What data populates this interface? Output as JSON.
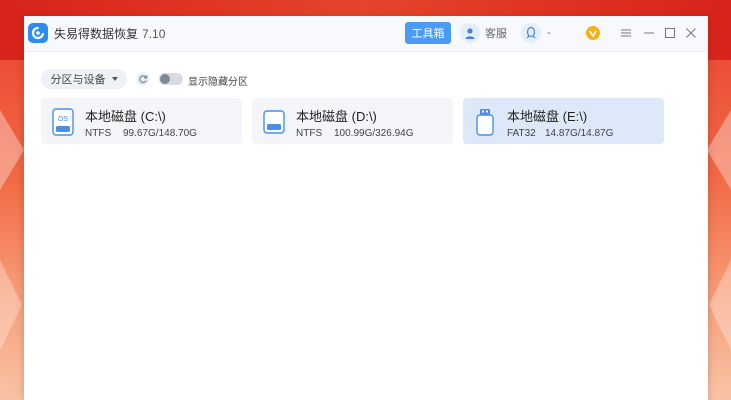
{
  "app": {
    "title": "失易得数据恢复",
    "version": "7.10"
  },
  "titlebar": {
    "toolbox_label": "工具箱",
    "service_label": "客服",
    "account_label": "-"
  },
  "filter": {
    "dropdown_label": "分区与设备",
    "toggle_label": "显示隐藏分区",
    "toggle_on": false
  },
  "disks": [
    {
      "name": "本地磁盘 (C:\\)",
      "fs": "NTFS",
      "size": "99.67G/148.70G",
      "icon": "system-drive-icon",
      "selected": false
    },
    {
      "name": "本地磁盘 (D:\\)",
      "fs": "NTFS",
      "size": "100.99G/326.94G",
      "icon": "hard-drive-icon",
      "selected": false
    },
    {
      "name": "本地磁盘 (E:\\)",
      "fs": "FAT32",
      "size": "14.87G/14.87G",
      "icon": "usb-drive-icon",
      "selected": true
    }
  ],
  "colors": {
    "accent": "#4a9bf5",
    "selected_card": "#dde9f8",
    "card": "#f3f5f8",
    "vip": "#f3b21a"
  }
}
